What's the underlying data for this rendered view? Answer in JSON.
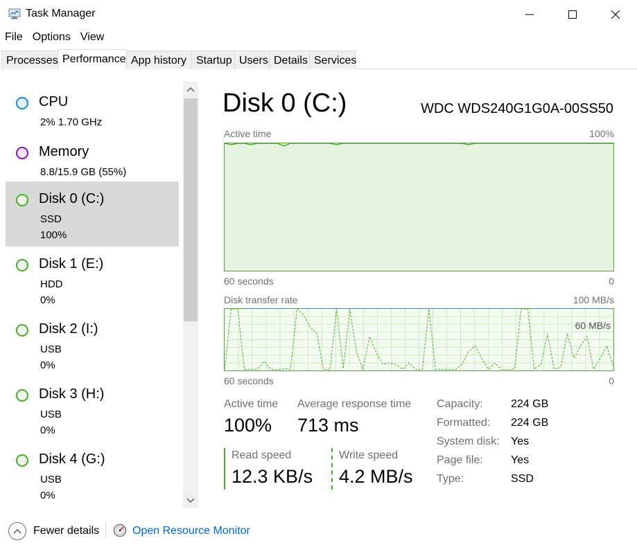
{
  "window": {
    "title": "Task Manager",
    "icon": "task-manager-icon"
  },
  "menu": [
    "File",
    "Options",
    "View"
  ],
  "tabs": [
    {
      "label": "Processes",
      "active": false
    },
    {
      "label": "Performance",
      "active": true
    },
    {
      "label": "App history",
      "active": false
    },
    {
      "label": "Startup",
      "active": false
    },
    {
      "label": "Users",
      "active": false
    },
    {
      "label": "Details",
      "active": false
    },
    {
      "label": "Services",
      "active": false
    }
  ],
  "sidebar": {
    "items": [
      {
        "name": "CPU",
        "line1": "2%  1.70 GHz",
        "line2": "",
        "color": "#1a86d4",
        "fill": "#e8f2fb"
      },
      {
        "name": "Memory",
        "line1": "8.8/15.9 GB (55%)",
        "line2": "",
        "color": "#8b12ae",
        "fill": "#f3e5f7"
      },
      {
        "name": "Disk 0 (C:)",
        "line1": "SSD",
        "line2": "100%",
        "color": "#4ea72e",
        "fill": "#eef7ea",
        "selected": true
      },
      {
        "name": "Disk 1 (E:)",
        "line1": "HDD",
        "line2": "0%",
        "color": "#4ea72e",
        "fill": "#eef7ea"
      },
      {
        "name": "Disk 2 (I:)",
        "line1": "USB",
        "line2": "0%",
        "color": "#4ea72e",
        "fill": "#eef7ea"
      },
      {
        "name": "Disk 3 (H:)",
        "line1": "USB",
        "line2": "0%",
        "color": "#4ea72e",
        "fill": "#eef7ea"
      },
      {
        "name": "Disk 4 (G:)",
        "line1": "USB",
        "line2": "0%",
        "color": "#4ea72e",
        "fill": "#eef7ea"
      }
    ]
  },
  "detail": {
    "title": "Disk 0 (C:)",
    "model": "WDC WDS240G1G0A-00SS50",
    "active_chart": {
      "label": "Active time",
      "max_label": "100%",
      "time_label": "60 seconds",
      "zero_label": "0",
      "values_percent": [
        100,
        99,
        100,
        100,
        99,
        100,
        100,
        100,
        100,
        98,
        100,
        100,
        100,
        100,
        100,
        100,
        100,
        99,
        100,
        100,
        100,
        100,
        100,
        100,
        100,
        100,
        100,
        100,
        100,
        100,
        100,
        100,
        100,
        100,
        100,
        100,
        100,
        99,
        100,
        100,
        100,
        100,
        100,
        100,
        100,
        100,
        100,
        100,
        100,
        100,
        100,
        100,
        100,
        100,
        100,
        100,
        100,
        100,
        100,
        100
      ]
    },
    "transfer_chart": {
      "label": "Disk transfer rate",
      "max_label": "100 MB/s",
      "mid_label": "60 MB/s",
      "time_label": "60 seconds",
      "zero_label": "0",
      "scale_max": 100,
      "values_mb": [
        2,
        100,
        100,
        2,
        2,
        2,
        15,
        2,
        1,
        3,
        2,
        100,
        90,
        70,
        60,
        2,
        1,
        100,
        3,
        100,
        30,
        2,
        55,
        30,
        10,
        12,
        10,
        2,
        12,
        2,
        1,
        100,
        2,
        2,
        2,
        1,
        10,
        30,
        40,
        20,
        2,
        12,
        2,
        1,
        3,
        100,
        100,
        2,
        10,
        60,
        2,
        5,
        60,
        20,
        40,
        55,
        2,
        20,
        40,
        5
      ]
    },
    "stats": {
      "active_time_label": "Active time",
      "active_time_value": "100%",
      "avg_response_label": "Average response time",
      "avg_response_value": "713 ms",
      "read_label": "Read speed",
      "read_value": "12.3 KB/s",
      "write_label": "Write speed",
      "write_value": "4.2 MB/s"
    },
    "properties": [
      {
        "label": "Capacity:",
        "value": "224 GB"
      },
      {
        "label": "Formatted:",
        "value": "224 GB"
      },
      {
        "label": "System disk:",
        "value": "Yes"
      },
      {
        "label": "Page file:",
        "value": "Yes"
      },
      {
        "label": "Type:",
        "value": "SSD"
      }
    ]
  },
  "footer": {
    "fewer_details": "Fewer details",
    "resource_monitor": "Open Resource Monitor"
  },
  "colors": {
    "disk_line": "#4ea72e",
    "disk_fill": "#f4fbf1",
    "grid": "#cfe8c4",
    "link": "#0066cc",
    "selected_bg": "#d9d9d9"
  }
}
